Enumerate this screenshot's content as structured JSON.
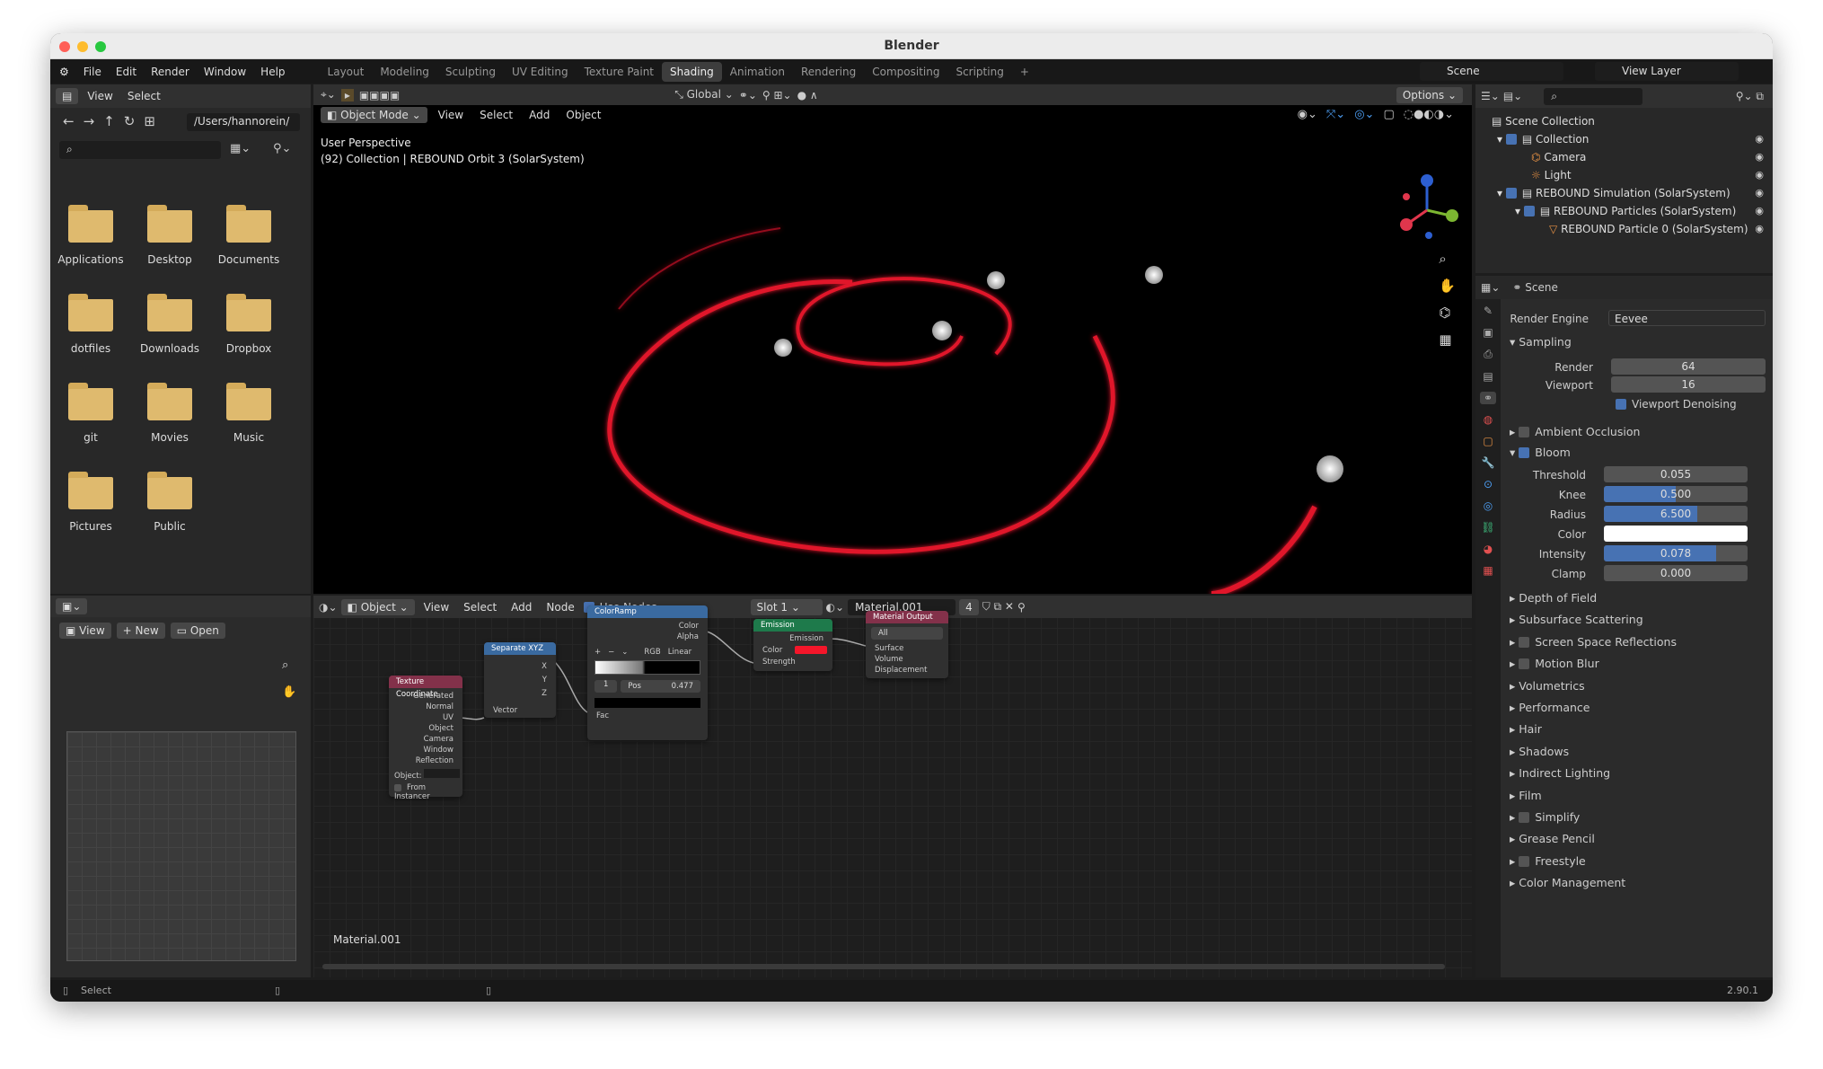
{
  "window": {
    "title": "Blender"
  },
  "menu": {
    "items": [
      "File",
      "Edit",
      "Render",
      "Window",
      "Help"
    ]
  },
  "workspaces": {
    "tabs": [
      "Layout",
      "Modeling",
      "Sculpting",
      "UV Editing",
      "Texture Paint",
      "Shading",
      "Animation",
      "Rendering",
      "Compositing",
      "Scripting"
    ],
    "active": "Shading",
    "add": "+"
  },
  "scene": {
    "name": "Scene",
    "view_layer": "View Layer"
  },
  "filebrowser": {
    "view": "View",
    "select": "Select",
    "path": "/Users/hannorein/",
    "folders": [
      "Applications",
      "Desktop",
      "Documents",
      "dotfiles",
      "Downloads",
      "Dropbox",
      "git",
      "Movies",
      "Music",
      "Pictures",
      "Public"
    ]
  },
  "viewport": {
    "mode": "Object Mode",
    "menus": [
      "View",
      "Select",
      "Add",
      "Object"
    ],
    "transform": "Global",
    "options": "Options",
    "info1": "User Perspective",
    "info2": "(92) Collection | REBOUND Orbit 3 (SolarSystem)"
  },
  "image_editor": {
    "view": "View",
    "new": "New",
    "open": "Open"
  },
  "node_editor": {
    "type": "Object",
    "menus": [
      "View",
      "Select",
      "Add",
      "Node"
    ],
    "use_nodes": "Use Nodes",
    "slot": "Slot 1",
    "material": "Material.001",
    "users": "4",
    "footer": "Material.001"
  },
  "nodes": {
    "texcoord": {
      "title": "Texture Coordinate",
      "outputs": [
        "Generated",
        "Normal",
        "UV",
        "Object",
        "Camera",
        "Window",
        "Reflection"
      ],
      "object": "Object:",
      "from_instancer": "From Instancer"
    },
    "sepxyz": {
      "title": "Separate XYZ",
      "outputs": [
        "X",
        "Y",
        "Z"
      ],
      "input": "Vector"
    },
    "ramp": {
      "title": "ColorRamp",
      "outputs": [
        "Color",
        "Alpha"
      ],
      "mode": "RGB",
      "interp": "Linear",
      "index": "1",
      "pos_label": "Pos",
      "pos": "0.477",
      "input": "Fac",
      "plus": "+",
      "minus": "−",
      "chev": "⌄"
    },
    "emission": {
      "title": "Emission",
      "output": "Emission",
      "inputs": [
        "Color",
        "Strength"
      ]
    },
    "matout": {
      "title": "Material Output",
      "target": "All",
      "inputs": [
        "Surface",
        "Volume",
        "Displacement"
      ]
    }
  },
  "outliner": {
    "items": [
      {
        "label": "Scene Collection"
      },
      {
        "label": "Collection"
      },
      {
        "label": "Camera"
      },
      {
        "label": "Light"
      },
      {
        "label": "REBOUND Simulation (SolarSystem)"
      },
      {
        "label": "REBOUND Particles (SolarSystem)"
      },
      {
        "label": "REBOUND Particle 0 (SolarSystem)"
      }
    ]
  },
  "properties": {
    "context": "Scene",
    "render_engine_label": "Render Engine",
    "render_engine": "Eevee",
    "sampling": "Sampling",
    "render_label": "Render",
    "render": "64",
    "viewport_label": "Viewport",
    "viewport": "16",
    "denoise": "Viewport Denoising",
    "ao": "Ambient Occlusion",
    "bloom": "Bloom",
    "bloom_fields": [
      {
        "label": "Threshold",
        "value": "0.055",
        "fill": 0
      },
      {
        "label": "Knee",
        "value": "0.500",
        "fill": 0.5
      },
      {
        "label": "Radius",
        "value": "6.500",
        "fill": 0.65
      },
      {
        "label": "Color",
        "value": "",
        "fill": 0
      },
      {
        "label": "Intensity",
        "value": "0.078",
        "fill": 0.78
      },
      {
        "label": "Clamp",
        "value": "0.000",
        "fill": 0
      }
    ],
    "sections": [
      {
        "label": "Depth of Field",
        "check": false
      },
      {
        "label": "Subsurface Scattering",
        "check": false
      },
      {
        "label": "Screen Space Reflections",
        "check": true
      },
      {
        "label": "Motion Blur",
        "check": true
      },
      {
        "label": "Volumetrics",
        "check": false
      },
      {
        "label": "Performance",
        "check": false
      },
      {
        "label": "Hair",
        "check": false
      },
      {
        "label": "Shadows",
        "check": false
      },
      {
        "label": "Indirect Lighting",
        "check": false
      },
      {
        "label": "Film",
        "check": false
      },
      {
        "label": "Simplify",
        "check": true
      },
      {
        "label": "Grease Pencil",
        "check": false
      },
      {
        "label": "Freestyle",
        "check": true
      },
      {
        "label": "Color Management",
        "check": false
      }
    ]
  },
  "status": {
    "left": "Select",
    "version": "2.90.1"
  },
  "colors": {
    "accent": "#4772b3",
    "orbit": "#e0142a",
    "emission": "#f4162a"
  }
}
